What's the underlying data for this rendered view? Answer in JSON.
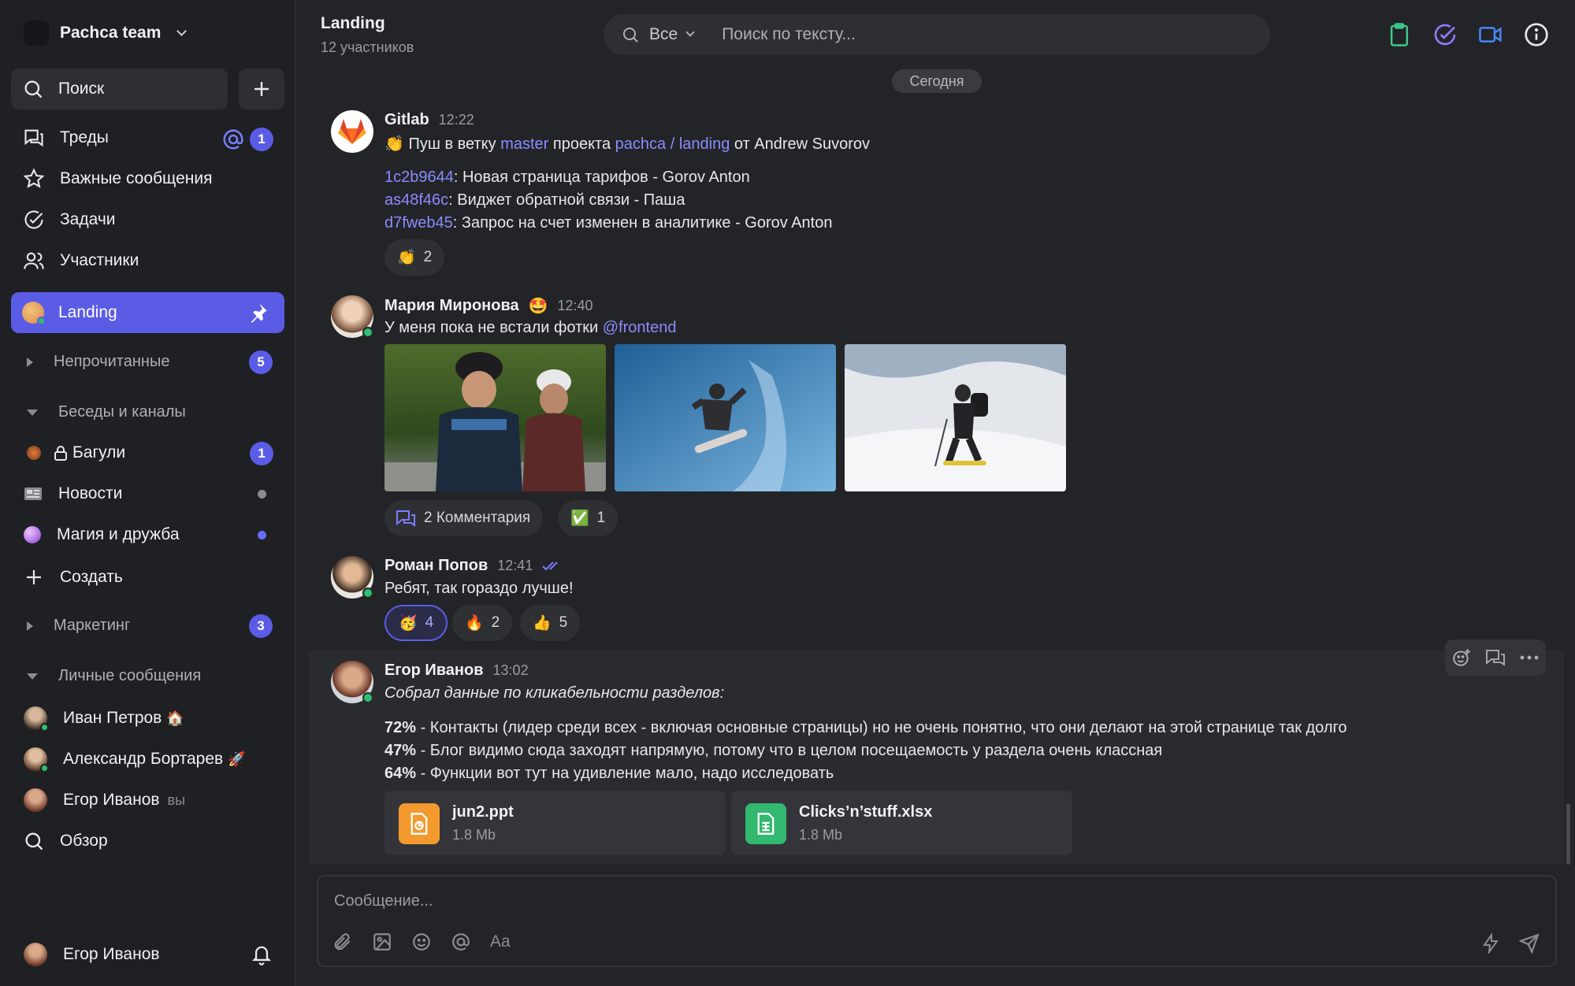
{
  "sidebar": {
    "team_name": "Pachca team",
    "search_label": "Поиск",
    "nav": [
      {
        "label": "Треды",
        "badge": "1"
      },
      {
        "label": "Важные сообщения"
      },
      {
        "label": "Задачи"
      },
      {
        "label": "Участники"
      }
    ],
    "active_channel": "Landing",
    "sections": [
      {
        "label": "Непрочитанные",
        "badge": "5"
      },
      {
        "label": "Беседы и каналы"
      },
      {
        "label": "Маркетинг",
        "badge": "3"
      },
      {
        "label": "Личные сообщения"
      }
    ],
    "channels": [
      {
        "label": "Багули",
        "badge": "1"
      },
      {
        "label": "Новости"
      },
      {
        "label": "Магия и дружба"
      }
    ],
    "create_label": "Создать",
    "dms": [
      {
        "label": "Иван Петров",
        "emoji": "🏠"
      },
      {
        "label": "Александр Бортарев",
        "emoji": "🚀"
      },
      {
        "label": "Егор Иванов",
        "suffix": "вы"
      }
    ],
    "overview_label": "Обзор",
    "current_user": "Егор Иванов"
  },
  "header": {
    "title": "Landing",
    "subtitle": "12 участников",
    "search_filter": "Все",
    "search_placeholder": "Поиск по тексту..."
  },
  "today_label": "Сегодня",
  "messages": [
    {
      "author": "Gitlab",
      "time": "12:22",
      "line1": {
        "emoji": "👏",
        "pre": "Пуш в ветку ",
        "branch": "master",
        "mid": " проекта ",
        "project": "pachca / landing",
        "post": " от Andrew Suvorov"
      },
      "commits": [
        {
          "hash": "1c2b9644",
          "text": ": Новая страница тарифов - Gorov Anton"
        },
        {
          "hash": "as48f46c",
          "text": ": Виджет обратной связи - Паша"
        },
        {
          "hash": "d7fweb45",
          "text": ": Запрос на счет изменен в аналитике - Gorov Anton"
        }
      ],
      "reactions": [
        {
          "emoji": "👏",
          "count": "2"
        }
      ]
    },
    {
      "author": "Мария Миронова",
      "author_emoji": "🤩",
      "time": "12:40",
      "text": "У меня пока не встали фотки ",
      "mention": "@frontend",
      "comments_label": "2 Комментария",
      "reactions": [
        {
          "emoji": "✅",
          "count": "1"
        }
      ]
    },
    {
      "author": "Роман Попов",
      "time": "12:41",
      "text": "Ребят, так гораздо лучше!",
      "reactions": [
        {
          "emoji": "🥳",
          "count": "4"
        },
        {
          "emoji": "🔥",
          "count": "2"
        },
        {
          "emoji": "👍",
          "count": "5"
        }
      ]
    },
    {
      "author": "Егор Иванов",
      "time": "13:02",
      "intro": "Собрал данные по кликабельности разделов:",
      "stats": [
        {
          "pct": "72%",
          "text": " - Контакты (лидер среди всех - включая основные страницы) но не очень понятно, что они делают на этой странице так долго"
        },
        {
          "pct": "47%",
          "text": " - Блог видимо сюда заходят напрямую, потому что в целом посещаемость у раздела очень классная"
        },
        {
          "pct": "64%",
          "text": " - Функции вот тут на удивление мало, надо исследовать"
        }
      ],
      "files": [
        {
          "name": "jun2.ppt",
          "size": "1.8 Mb"
        },
        {
          "name": "Clicks’n’stuff.xlsx",
          "size": "1.8 Mb"
        }
      ]
    }
  ],
  "composer": {
    "placeholder": "Сообщение...",
    "format_label": "Aa"
  },
  "colors": {
    "accent": "#5b5ce6",
    "link": "#8a8cff",
    "online": "#2fbf71",
    "background": "#232427",
    "sidebar": "#1f2023"
  }
}
